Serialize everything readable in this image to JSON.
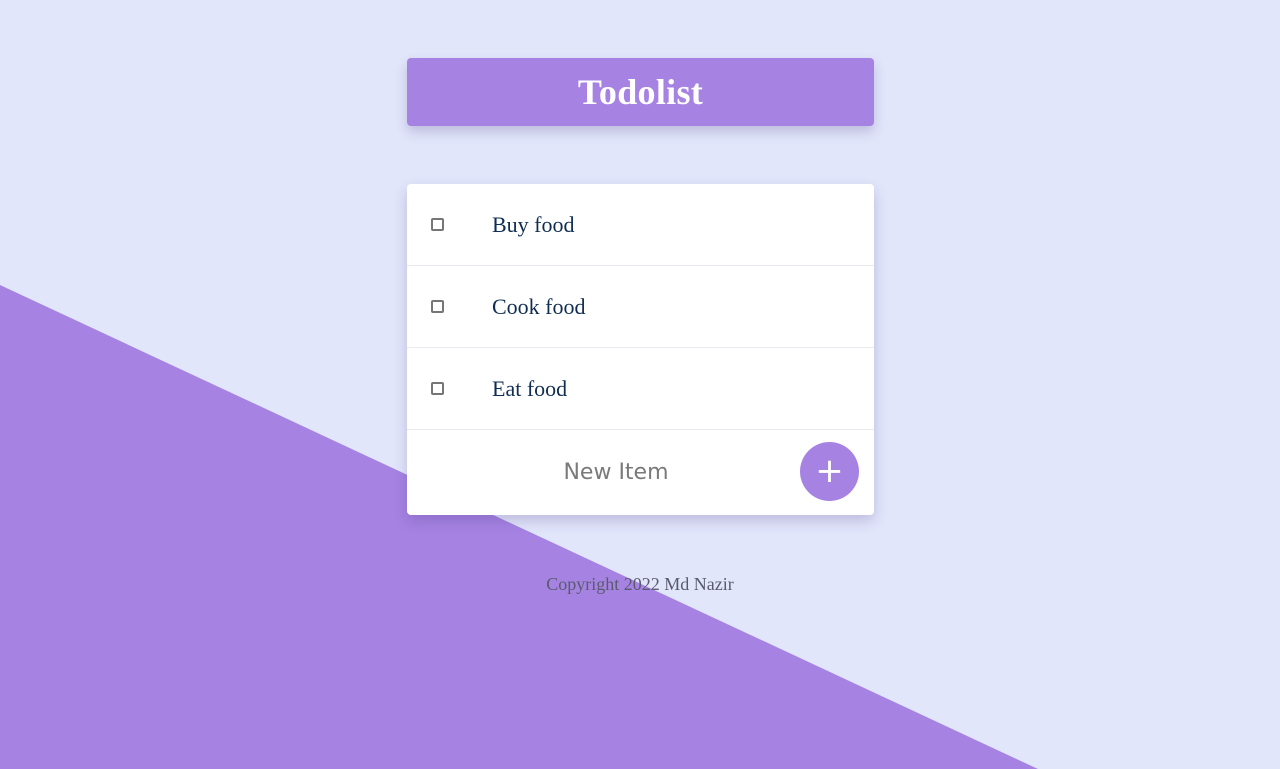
{
  "colors": {
    "background": "#E2E6FB",
    "accent": "#A683E3",
    "item_text": "#0F2D52"
  },
  "header": {
    "title": "Todolist"
  },
  "list": {
    "items": [
      {
        "label": "Buy food",
        "checked": false
      },
      {
        "label": "Cook food",
        "checked": false
      },
      {
        "label": "Eat food",
        "checked": false
      }
    ],
    "new_item": {
      "placeholder": "New Item",
      "value": ""
    },
    "add_button_label": "+"
  },
  "footer": {
    "copyright": "Copyright 2022 Md Nazir"
  }
}
